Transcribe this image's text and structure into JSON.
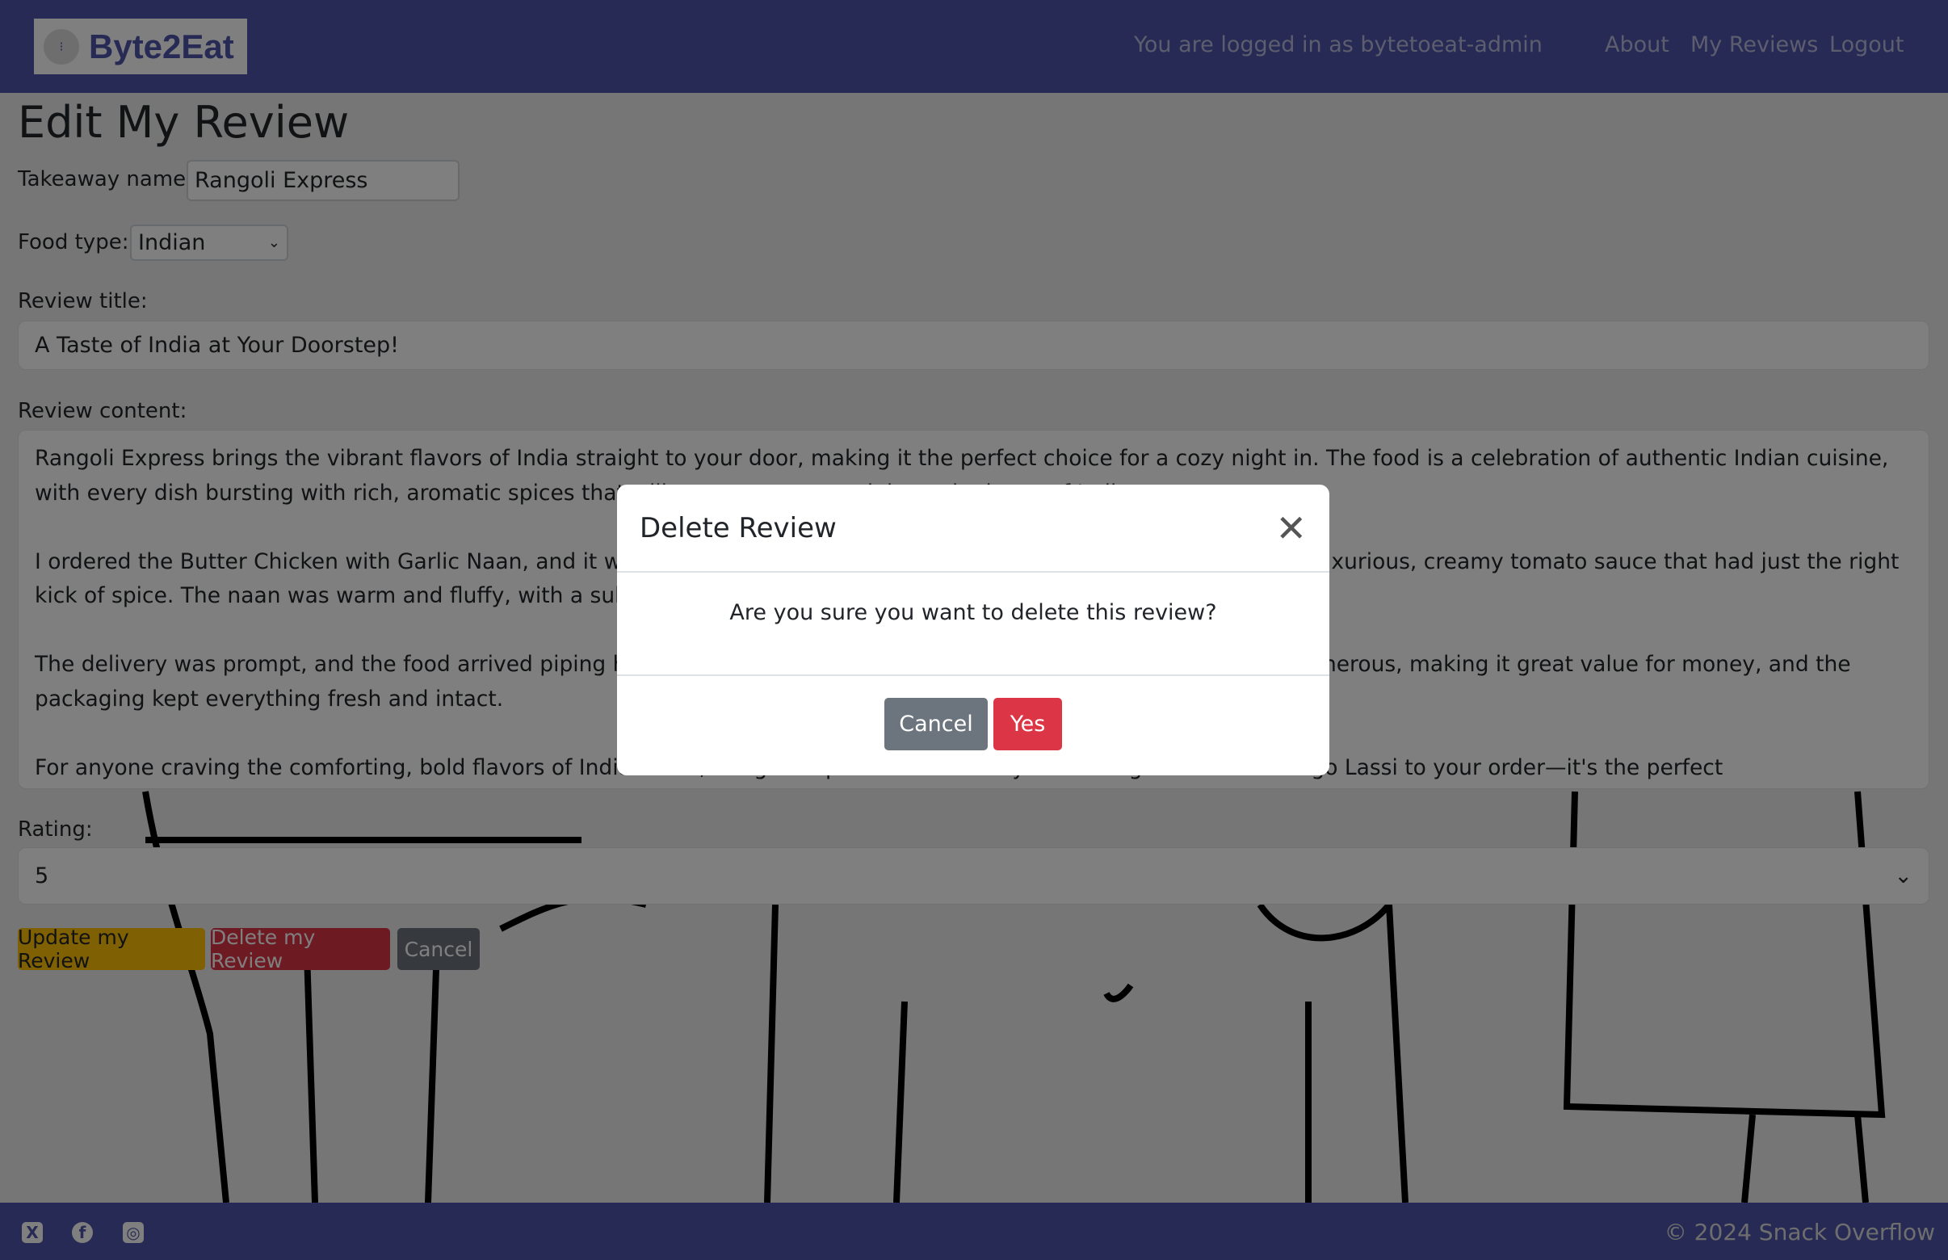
{
  "navbar": {
    "brand": "Byte2Eat",
    "logged_in": "You are logged in as bytetoeat-admin",
    "links": [
      "About",
      "My Reviews",
      "Logout"
    ]
  },
  "page": {
    "title": "Edit My Review"
  },
  "form": {
    "takeaway_label": "Takeaway name:",
    "takeaway_value": "Rangoli Express",
    "food_type_label": "Food type:",
    "food_type_value": "Indian",
    "review_title_label": "Review title:",
    "review_title_value": "A Taste of India at Your Doorstep!",
    "review_content_label": "Review content:",
    "review_content": [
      "Rangoli Express brings the vibrant flavors of India straight to your door, making it the perfect choice for a cozy night in. The food is a celebration of authentic Indian cuisine, with every dish bursting with rich, aromatic spices that will transport you straight to the heart of India.",
      "I ordered the Butter Chicken with Garlic Naan, and it was absolutely delicious. The chicken was tender and coated in a luxurious, creamy tomato sauce that had just the right kick of spice. The naan was warm and fluffy, with a subtle hint of garlic.",
      "The delivery was prompt, and the food arrived piping hot, as if it had just come out of the kitchen. The portions were generous, making it great value for money, and the packaging kept everything fresh and intact.",
      "For anyone craving the comforting, bold flavors of Indian food, Rangoli Express is a must-try. Don't forget to add a Mango Lassi to your order—it's the perfect"
    ],
    "rating_label": "Rating:",
    "rating_value": "5",
    "buttons": {
      "update": "Update my Review",
      "delete": "Delete my Review",
      "cancel": "Cancel"
    }
  },
  "footer": {
    "icons": [
      "x-icon",
      "facebook-icon",
      "instagram-icon"
    ],
    "copyright": "© 2024 Snack Overflow"
  },
  "modal": {
    "title": "Delete Review",
    "message": "Are you sure you want to delete this review?",
    "cancel": "Cancel",
    "yes": "Yes"
  }
}
